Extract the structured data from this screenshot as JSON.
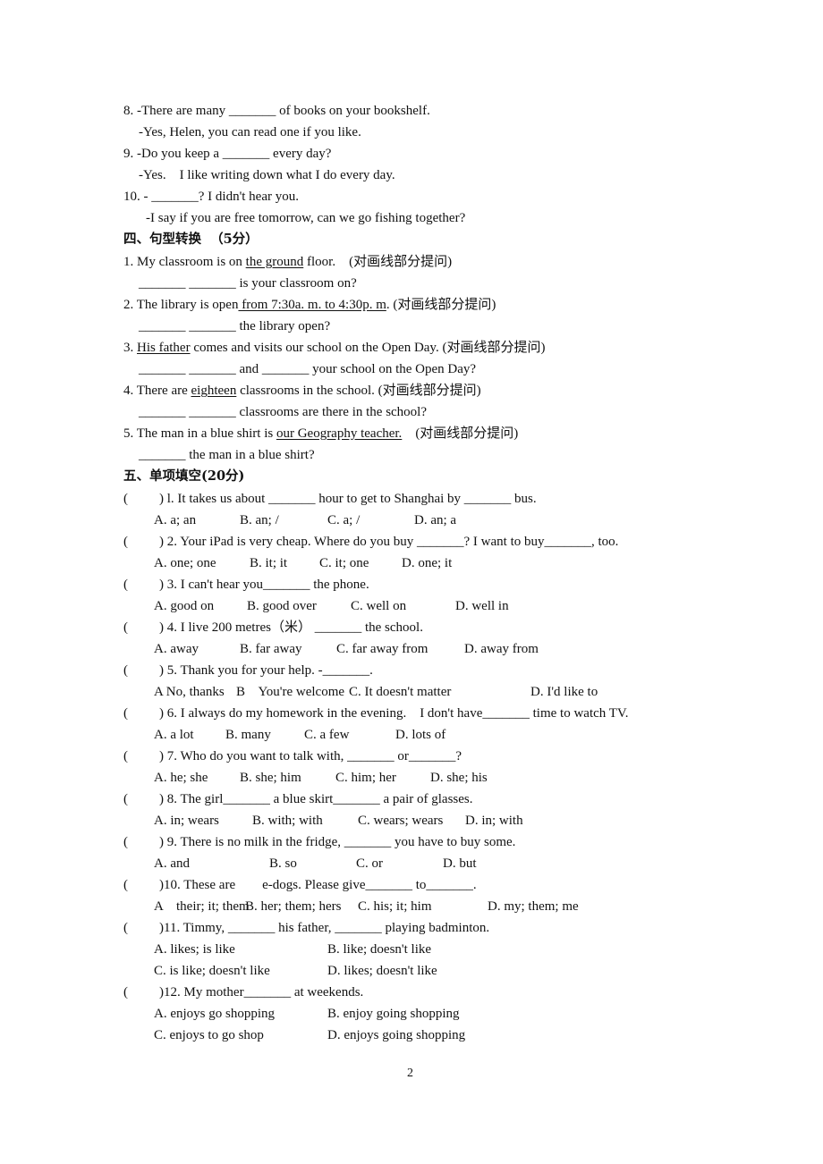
{
  "section3_tail": [
    {
      "id": "q8a",
      "text": "8. -There are many _______ of books on your bookshelf."
    },
    {
      "id": "q8b",
      "text": "-Yes, Helen, you can read one if you like."
    },
    {
      "id": "q9a",
      "text": "9. -Do you keep a _______ every day?"
    },
    {
      "id": "q9b",
      "text": "-Yes.    I like writing down what I do every day."
    },
    {
      "id": "q10a",
      "text": "10. - _______? I didn't hear you."
    },
    {
      "id": "q10b",
      "text": "-I say if you are free tomorrow, can we go fishing together?"
    }
  ],
  "section4": {
    "heading": "四、句型转换  （5分）",
    "items": [
      {
        "pre": "1. My classroom is on ",
        "underlined": "the ground",
        "post": " floor.    (对画线部分提问)",
        "answer": "_______ _______ is your classroom on?"
      },
      {
        "pre": "2. The library is open",
        "underlined": " from 7:30a. m. to 4:30p. m",
        "post": ". (对画线部分提问)",
        "answer": "_______ _______ the library open?"
      },
      {
        "pre": "3. ",
        "underlined": "His father",
        "post": " comes and visits our school on the Open Day. (对画线部分提问)",
        "answer": "_______ _______ and _______ your school on the Open Day?"
      },
      {
        "pre": "4. There are ",
        "underlined": "eighteen",
        "post": " classrooms in the school. (对画线部分提问)",
        "answer": "_______ _______ classrooms are there in the school?"
      },
      {
        "pre": "5. The man in a blue shirt is ",
        "underlined": "our Geography teacher.",
        "post": "    (对画线部分提问)",
        "answer": "_______ the man in a blue shirt?"
      }
    ]
  },
  "section5": {
    "heading": "五、单项填空(20分)",
    "paren": "(",
    "questions": [
      {
        "stem": ") l. It takes us about _______ hour to get to Shanghai by _______ bus.",
        "options": [
          "A. a; an",
          "B. an; /",
          "C. a; /",
          "D. an; a"
        ]
      },
      {
        "stem": ") 2. Your iPad is very cheap. Where do you buy _______? I want to buy_______, too.",
        "options": [
          "A. one; one",
          "B. it; it",
          "C. it; one",
          "D. one; it"
        ]
      },
      {
        "stem": ") 3. I can't hear you_______ the phone.",
        "options": [
          "A. good on",
          "B. good over",
          "C. well on",
          "D. well in"
        ]
      },
      {
        "stem": ") 4. I live 200 metres（米） _______ the school.",
        "options": [
          "A. away",
          "B. far away",
          "C. far away from",
          "D. away from"
        ]
      },
      {
        "stem": ") 5. Thank you for your help. -_______.",
        "options": [
          "A No, thanks",
          "B    You're welcome",
          "C. It doesn't matter",
          "D. I'd like to"
        ]
      },
      {
        "stem": ") 6. I always do my homework in the evening.    I don't have_______ time to watch TV.",
        "options": [
          "A. a lot",
          "B. many",
          "C. a few",
          "D. lots of"
        ]
      },
      {
        "stem": ") 7. Who do you want to talk with, _______ or_______?",
        "options": [
          "A. he; she",
          "B. she; him",
          "C. him; her",
          "D. she; his"
        ]
      },
      {
        "stem": ") 8. The girl_______ a blue skirt_______ a pair of glasses.",
        "options": [
          "A. in; wears",
          "B. with; with",
          "C. wears; wears",
          "D. in; with"
        ]
      },
      {
        "stem": ") 9. There is no milk in the fridge, _______ you have to buy some.",
        "options": [
          "A. and",
          "B. so",
          "C. or",
          "D. but"
        ]
      },
      {
        "stem": ")10. These are        e-dogs. Please give_______ to_______.",
        "options": [
          "A    their; it; them",
          "B. her; them; hers",
          "C. his; it; him",
          "D. my; them; me"
        ]
      },
      {
        "stem": ")11. Timmy, _______ his father, _______ playing badminton.",
        "options": [
          "A. likes; is like",
          "B. like; doesn't like",
          "C. is like; doesn't like",
          "D. likes; doesn't like"
        ]
      },
      {
        "stem": ")12. My mother_______ at weekends.",
        "options": [
          "A. enjoys go shopping",
          "B. enjoy going shopping",
          "C. enjoys to go shop",
          "D. enjoys going shopping"
        ]
      }
    ]
  },
  "page_number": "2"
}
